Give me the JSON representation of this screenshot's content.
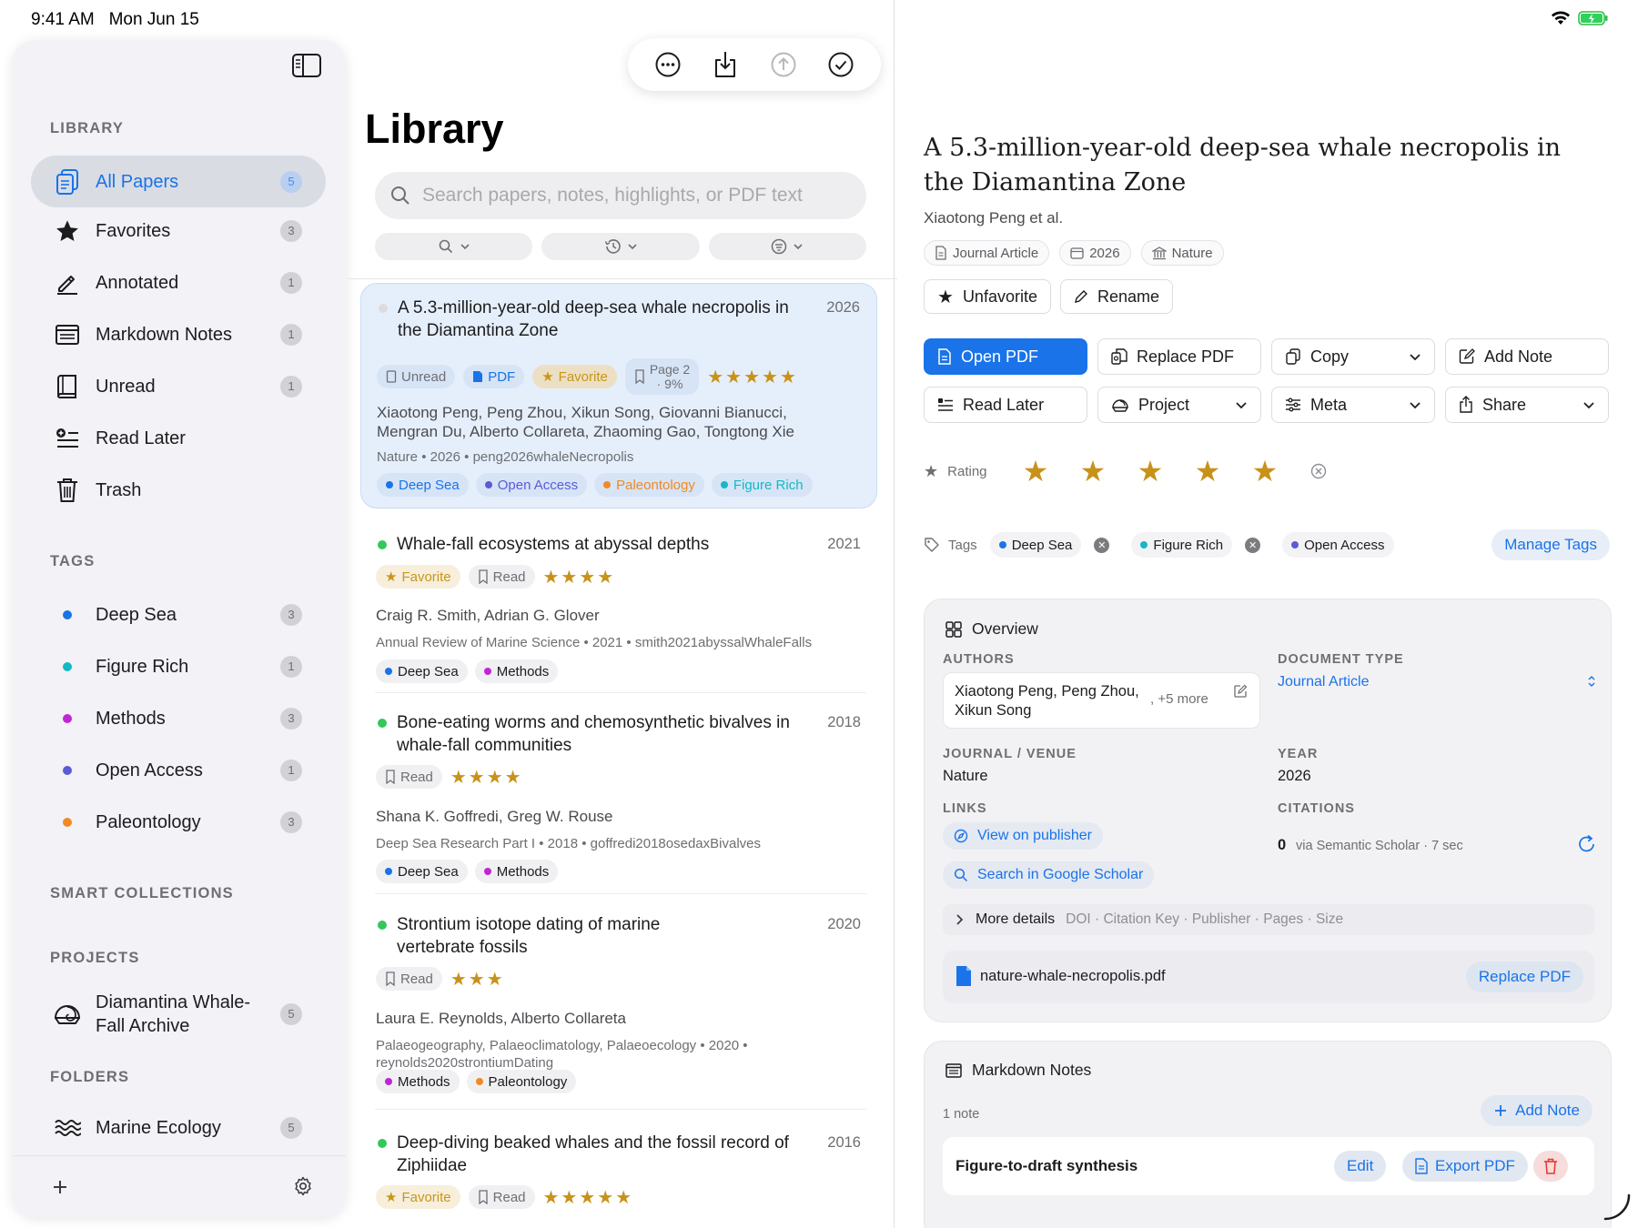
{
  "status": {
    "time": "9:41 AM",
    "date": "Mon Jun 15"
  },
  "sidebar": {
    "library_header": "LIBRARY",
    "library_items": [
      {
        "label": "All Papers",
        "count": "5",
        "icon": "document-stack-icon",
        "selected": true
      },
      {
        "label": "Favorites",
        "count": "3",
        "icon": "star-icon"
      },
      {
        "label": "Annotated",
        "count": "1",
        "icon": "pencil-icon"
      },
      {
        "label": "Markdown Notes",
        "count": "1",
        "icon": "note-icon"
      },
      {
        "label": "Unread",
        "count": "1",
        "icon": "book-icon"
      },
      {
        "label": "Read Later",
        "count": "",
        "icon": "list-add-icon"
      },
      {
        "label": "Trash",
        "count": "",
        "icon": "trash-icon"
      }
    ],
    "tags_header": "TAGS",
    "tags": [
      {
        "label": "Deep Sea",
        "count": "3",
        "color": "#1a73e8"
      },
      {
        "label": "Figure Rich",
        "count": "1",
        "color": "#14b8c4"
      },
      {
        "label": "Methods",
        "count": "3",
        "color": "#c026d3"
      },
      {
        "label": "Open Access",
        "count": "1",
        "color": "#5b5bd6"
      },
      {
        "label": "Paleontology",
        "count": "3",
        "color": "#f08a24"
      }
    ],
    "smart_header": "SMART COLLECTIONS",
    "projects_header": "PROJECTS",
    "projects": [
      {
        "line1": "Diamantina Whale-",
        "line2": "Fall Archive",
        "count": "5"
      }
    ],
    "folders_header": "FOLDERS",
    "folders": [
      {
        "label": "Marine Ecology",
        "count": "5"
      }
    ]
  },
  "middle": {
    "title": "Library",
    "search_placeholder": "Search papers, notes, highlights, or PDF text",
    "papers": [
      {
        "title": "A 5.3-million-year-old deep-sea whale necropolis in the Diamantina Zone",
        "year": "2026",
        "status": "Unread",
        "pdf": "PDF",
        "favorite": "Favorite",
        "page_line1": "Page 2",
        "page_line2": "· 9%",
        "stars": "★★★★★",
        "authors": "Xiaotong Peng, Peng Zhou, Xikun Song, Giovanni Bianucci, Mengran Du, Alberto Collareta, Zhaoming Gao, Tongtong Xie",
        "meta": "Nature • 2026 • peng2026whaleNecropolis",
        "tags": [
          {
            "label": "Deep Sea",
            "color": "#1a73e8"
          },
          {
            "label": "Open Access",
            "color": "#5b5bd6"
          },
          {
            "label": "Paleontology",
            "color": "#f08a24"
          },
          {
            "label": "Figure Rich",
            "color": "#14b8c4"
          }
        ]
      },
      {
        "title": "Whale-fall ecosystems at abyssal depths",
        "year": "2021",
        "favorite": "Favorite",
        "status": "Read",
        "stars": "★★★★",
        "authors": "Craig R. Smith, Adrian G. Glover",
        "meta": "Annual Review of Marine Science • 2021 • smith2021abyssalWhaleFalls",
        "tags": [
          {
            "label": "Deep Sea",
            "color": "#1a73e8"
          },
          {
            "label": "Methods",
            "color": "#c026d3"
          }
        ]
      },
      {
        "title": "Bone-eating worms and chemosynthetic bivalves in whale-fall communities",
        "year": "2018",
        "status": "Read",
        "stars": "★★★★",
        "authors": "Shana K. Goffredi, Greg W. Rouse",
        "meta": "Deep Sea Research Part I • 2018 • goffredi2018osedaxBivalves",
        "tags": [
          {
            "label": "Deep Sea",
            "color": "#1a73e8"
          },
          {
            "label": "Methods",
            "color": "#c026d3"
          }
        ]
      },
      {
        "title": "Strontium isotope dating of marine vertebrate fossils",
        "year": "2020",
        "status": "Read",
        "stars": "★★★",
        "authors": "Laura E. Reynolds, Alberto Collareta",
        "meta": "Palaeogeography, Palaeoclimatology, Palaeoecology • 2020 • reynolds2020strontiumDating",
        "tags": [
          {
            "label": "Methods",
            "color": "#c026d3"
          },
          {
            "label": "Paleontology",
            "color": "#f08a24"
          }
        ]
      },
      {
        "title": "Deep-diving beaked whales and the fossil record of Ziphiidae",
        "year": "2016",
        "favorite": "Favorite",
        "status": "Read",
        "stars": "★★★★★"
      }
    ]
  },
  "detail": {
    "title": "A 5.3-million-year-old deep-sea whale necropolis in the Diamantina Zone",
    "authors": "Xiaotong Peng et al.",
    "type_chip": "Journal Article",
    "year_chip": "2026",
    "venue_chip": "Nature",
    "unfavorite": "Unfavorite",
    "rename": "Rename",
    "buttons": {
      "open_pdf": "Open PDF",
      "replace_pdf": "Replace PDF",
      "copy": "Copy",
      "add_note": "Add Note",
      "read_later": "Read Later",
      "project": "Project",
      "meta": "Meta",
      "share": "Share"
    },
    "rating_label": "Rating",
    "rating": 5,
    "tags_label": "Tags",
    "tags": [
      {
        "label": "Deep Sea",
        "color": "#1a73e8"
      },
      {
        "label": "Figure Rich",
        "color": "#14b8c4"
      },
      {
        "label": "Open Access",
        "color": "#5b5bd6"
      }
    ],
    "manage_tags": "Manage Tags",
    "overview": {
      "title": "Overview",
      "authors_label": "AUTHORS",
      "authors_line1": "Xiaotong Peng, Peng Zhou,",
      "authors_line2": "Xikun Song",
      "authors_more": "+5 more",
      "doctype_label": "DOCUMENT TYPE",
      "doctype": "Journal Article",
      "venue_label": "JOURNAL / VENUE",
      "venue": "Nature",
      "year_label": "YEAR",
      "year": "2026",
      "links_label": "LINKS",
      "link_publisher": "View on publisher",
      "link_scholar": "Search in Google Scholar",
      "citations_label": "CITATIONS",
      "citations": "0",
      "citations_source": "via Semantic Scholar · 7 sec",
      "more_details": "More details",
      "more_details_hint": "DOI · Citation Key · Publisher · Pages · Size",
      "file_name": "nature-whale-necropolis.pdf",
      "replace_pdf": "Replace PDF"
    },
    "notes": {
      "title": "Markdown Notes",
      "count": "1 note",
      "add_note": "Add Note",
      "note_title": "Figure-to-draft synthesis",
      "edit": "Edit",
      "export_pdf": "Export PDF"
    }
  },
  "colors": {
    "accent": "#1a73e8",
    "star": "#c8921a",
    "danger": "#e53935"
  }
}
